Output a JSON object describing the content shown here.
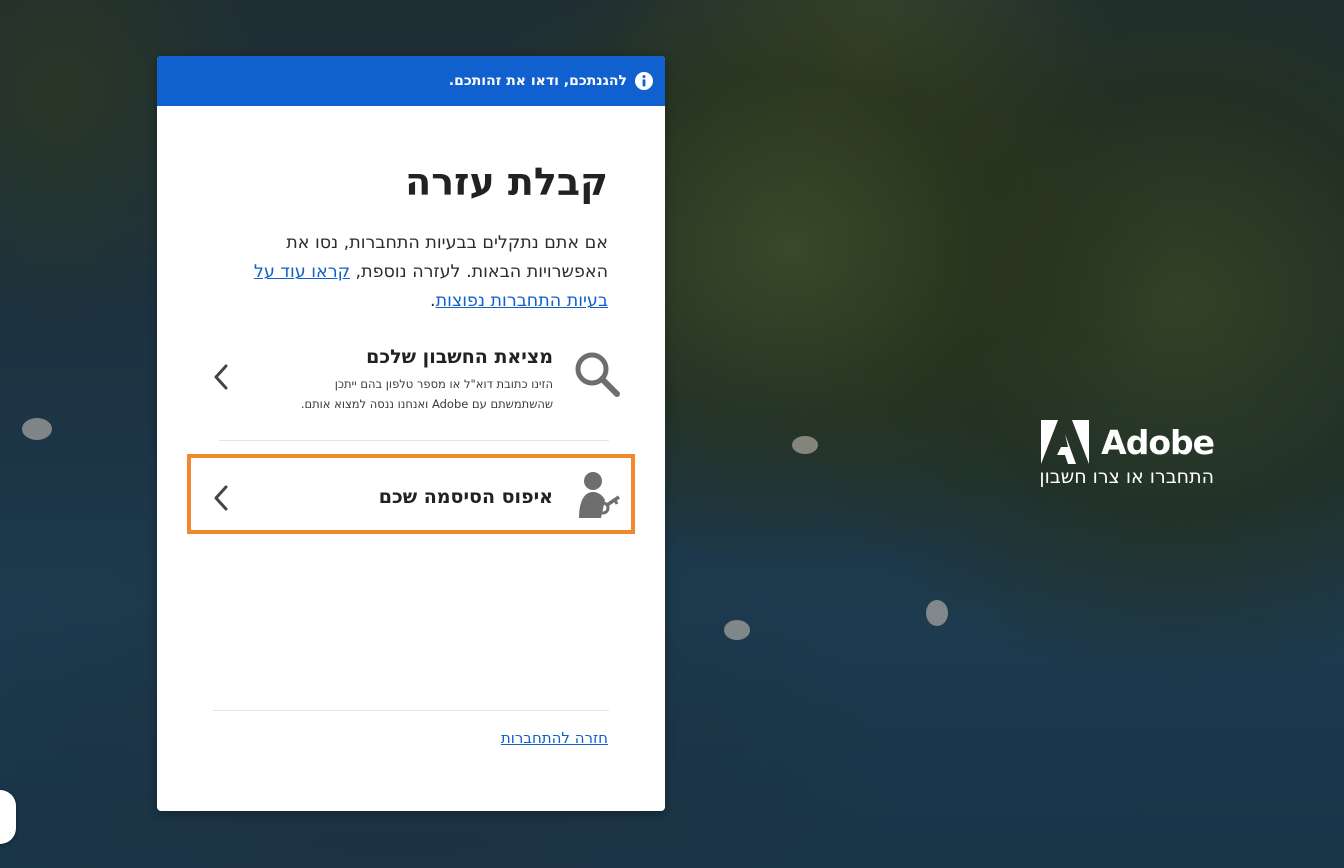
{
  "background": {
    "brand_name": "Adobe",
    "brand_subtitle": "התחברו או צרו חשבון",
    "logo_icon": "adobe-logo-icon"
  },
  "card": {
    "banner": {
      "icon": "info-icon",
      "text": "להגנתכם, ודאו את זהותכם."
    },
    "title": "קבלת עזרה",
    "intro_text": "אם אתם נתקלים בבעיות התחברות, נסו את האפשרויות הבאות. לעזרה נוספת, ",
    "intro_link": "קראו עוד על בעיות התחברות נפוצות",
    "intro_end": ".",
    "options": [
      {
        "icon": "magnifier-icon",
        "title": "מציאת החשבון שלכם",
        "description": "הזינו כתובת דוא\"ל או מספר טלפון בהם ייתכן שהשתמשתם עם Adobe ואנחנו ננסה למצוא אותם.",
        "chevron": "chevron-left-icon"
      },
      {
        "icon": "person-key-icon",
        "title": "איפוס הסיסמה שכם",
        "chevron": "chevron-left-icon"
      }
    ],
    "back_link": "חזרה להתחברות"
  },
  "colors": {
    "banner_blue": "#1060d0",
    "link_blue": "#1060c8",
    "highlight_orange": "#f0892e"
  }
}
